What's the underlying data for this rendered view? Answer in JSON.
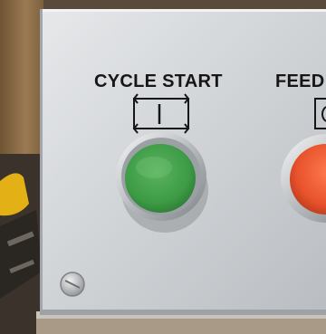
{
  "panel": {
    "cycle_start": {
      "label": "CYCLE START",
      "symbol": "cycle-start-symbol",
      "button_color": "#3d9b45"
    },
    "feed": {
      "label": "FEED",
      "symbol": "feed-hold-symbol",
      "button_color": "#e8532c"
    }
  },
  "colors": {
    "panel": "#c9ccd0",
    "panel_highlight": "#e3e5e8",
    "wood": "#8a6a45",
    "bezel": "#d8dadd"
  }
}
